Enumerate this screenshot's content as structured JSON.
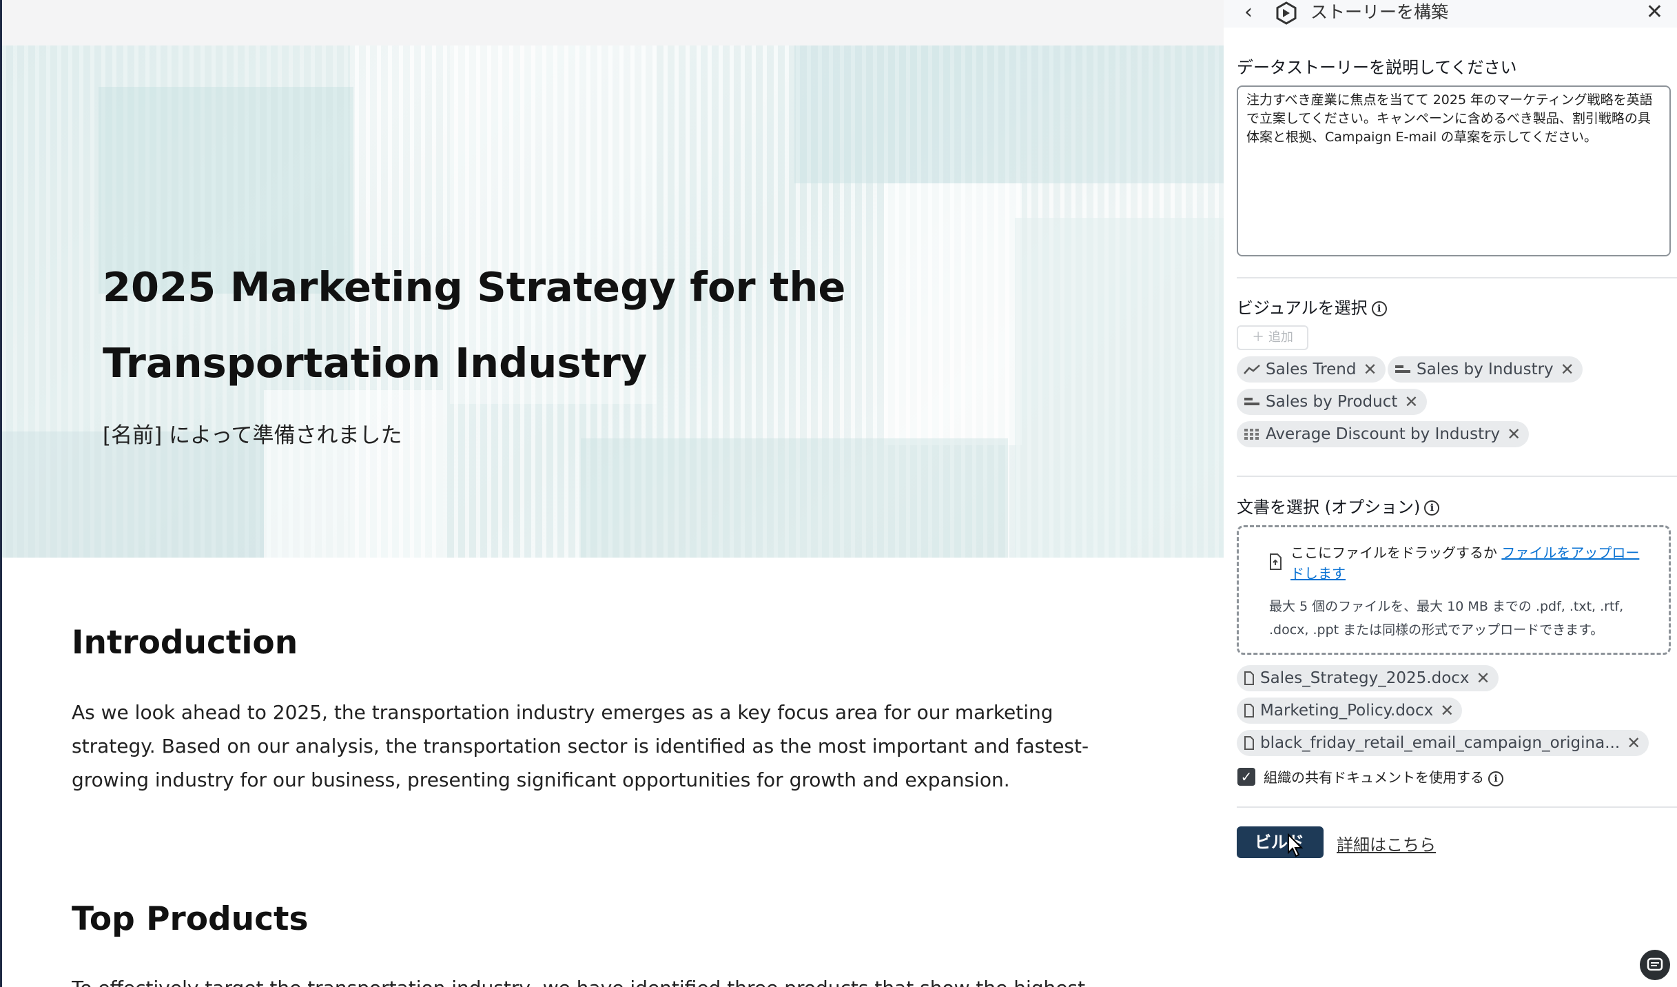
{
  "hero": {
    "title": "2025 Marketing Strategy for the Transportation Industry",
    "subtitle": "[名前] によって準備されました"
  },
  "sections": [
    {
      "heading": "Introduction",
      "body": "As we look ahead to 2025, the transportation industry emerges as a key focus area for our marketing strategy. Based on our analysis, the transportation sector is identified as the most important and fastest-growing industry for our business, presenting significant opportunities for growth and expansion."
    },
    {
      "heading": "Top Products",
      "body": "To effectively target the transportation industry, we have identified three products that show the highest potential"
    }
  ],
  "panel": {
    "title": "ストーリーを構築",
    "describe_label": "データストーリーを説明してください",
    "prompt_text": "注力すべき産業に焦点を当てて 2025 年のマーケティング戦略を英語で立案してください。キャンペーンに含めるべき製品、割引戦略の具体案と根拠、Campaign E-mail の草案を示してください。",
    "visuals_label": "ビジュアルを選択",
    "add_label": "＋ 追加",
    "visuals": [
      {
        "label": "Sales Trend",
        "icon": "line-chart-icon"
      },
      {
        "label": "Sales by Industry",
        "icon": "bar-chart-icon"
      },
      {
        "label": "Sales by Product",
        "icon": "bar-chart-icon"
      },
      {
        "label": "Average Discount by Industry",
        "icon": "heatmap-icon"
      }
    ],
    "docs_label": "文書を選択 (オプション)",
    "drop_text": "ここにファイルをドラッグするか",
    "upload_link": "ファイルをアップロードします",
    "drop_hint": "最大 5 個のファイルを、最大 10 MB までの .pdf, .txt, .rtf, .docx, .ppt または同様の形式でアップロードできます。",
    "documents": [
      "Sales_Strategy_2025.docx",
      "Marketing_Policy.docx",
      "black_friday_retail_email_campaign_origina..."
    ],
    "shared_docs_label": "組織の共有ドキュメントを使用する",
    "shared_docs_checked": true,
    "build_label": "ビルド",
    "learn_more": "詳細はこちら"
  },
  "colors": {
    "primary_button": "#1e3a57",
    "link": "#0972d3",
    "token_bg": "#e9ebed"
  }
}
